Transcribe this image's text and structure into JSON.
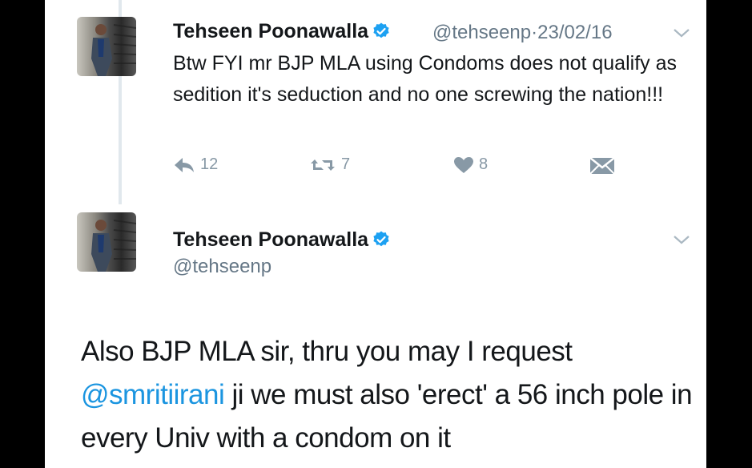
{
  "tweet1": {
    "name": "Tehseen Poonawalla",
    "handle": "@tehseenp",
    "separator": "·",
    "date": "23/02/16",
    "text": "Btw FYI mr BJP MLA using Condoms does not qualify as sedition it's seduction and no one screwing the nation!!!",
    "reply_count": "12",
    "retweet_count": "7",
    "like_count": "8"
  },
  "tweet2": {
    "name": "Tehseen Poonawalla",
    "handle": "@tehseenp",
    "text_part1": "Also BJP MLA sir, thru you may I request ",
    "mention": "@smritiirani",
    "text_part2": " ji we must also 'erect' a 56 inch pole in every Univ with a condom on it"
  },
  "colors": {
    "verified": "#1da1f2",
    "mention": "#1b95e0",
    "muted": "#657786",
    "icon": "#8899a6"
  },
  "icons": [
    "verified-badge-icon",
    "chevron-down-icon",
    "reply-icon",
    "retweet-icon",
    "heart-icon",
    "direct-message-icon"
  ]
}
